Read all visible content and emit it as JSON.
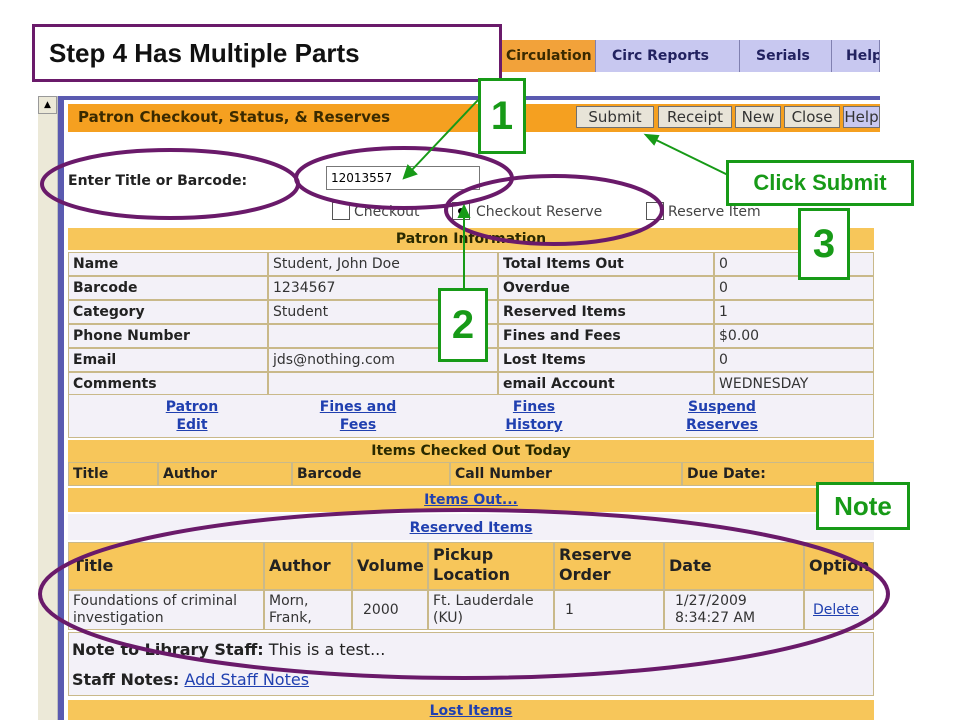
{
  "step_title": "Step 4 Has Multiple Parts",
  "nav_tabs": [
    "Circulation",
    "Circ Reports",
    "Serials",
    "Help"
  ],
  "window": {
    "title": "Patron Checkout, Status, & Reserves",
    "buttons": {
      "submit": "Submit",
      "receipt": "Receipt",
      "new": "New",
      "close": "Close",
      "help": "Help"
    }
  },
  "form": {
    "barcode_label": "Enter Title or Barcode:",
    "barcode_value": "12013557",
    "radios": {
      "checkout": "Checkout",
      "checkout_reserve": "Checkout Reserve",
      "reserve_item": "Reserve Item"
    },
    "selected_radio": "checkout_reserve"
  },
  "patron_info": {
    "header": "Patron Information",
    "left": [
      {
        "label": "Name",
        "value": "Student, John Doe"
      },
      {
        "label": "Barcode",
        "value": "1234567"
      },
      {
        "label": "Category",
        "value": "Student"
      },
      {
        "label": "Phone Number",
        "value": ""
      },
      {
        "label": "Email",
        "value": "jds@nothing.com"
      },
      {
        "label": "Comments",
        "value": ""
      }
    ],
    "right": [
      {
        "label": "Total Items Out",
        "value": "0"
      },
      {
        "label": "Overdue",
        "value": "0"
      },
      {
        "label": "Reserved Items",
        "value": "1"
      },
      {
        "label": "Fines and Fees",
        "value": "$0.00"
      },
      {
        "label": "Lost Items",
        "value": "0"
      },
      {
        "label": "email Account",
        "value": "WEDNESDAY"
      }
    ]
  },
  "links": {
    "patron_edit": [
      "Patron",
      "Edit"
    ],
    "fines_and_fees": [
      "Fines and",
      "Fees"
    ],
    "fines_history": [
      "Fines",
      "History"
    ],
    "suspend_reserves": [
      "Suspend",
      "Reserves"
    ]
  },
  "checked_out_today": {
    "header": "Items Checked Out Today",
    "columns": [
      "Title",
      "Author",
      "Barcode",
      "Call Number",
      "Due Date:"
    ]
  },
  "items_out_link": "Items Out...",
  "reserved_items": {
    "header": "Reserved Items",
    "columns": [
      "Title",
      "Author",
      "Volume",
      "Pickup Location",
      "Reserve Order",
      "Date",
      "Option"
    ],
    "rows": [
      {
        "title": "Foundations of criminal investigation",
        "author": "Morn, Frank,",
        "volume": "2000",
        "pickup": "Ft. Lauderdale (KU)",
        "order": "1",
        "date": "1/27/2009 8:34:27 AM",
        "option": "Delete"
      }
    ]
  },
  "note_to_staff": {
    "label": "Note to Library Staff:",
    "value": "This is a test..."
  },
  "staff_notes": {
    "label": "Staff Notes:",
    "link": "Add Staff Notes"
  },
  "lost_items_link": "Lost Items",
  "annotations": {
    "num1": "1",
    "num2": "2",
    "num3": "3",
    "click_submit": "Click Submit",
    "note": "Note"
  },
  "colors": {
    "accent_orange": "#f5a020",
    "band_gold": "#f7c65a",
    "callout_green": "#179a17",
    "ellipse_purple": "#6a1a6a"
  }
}
